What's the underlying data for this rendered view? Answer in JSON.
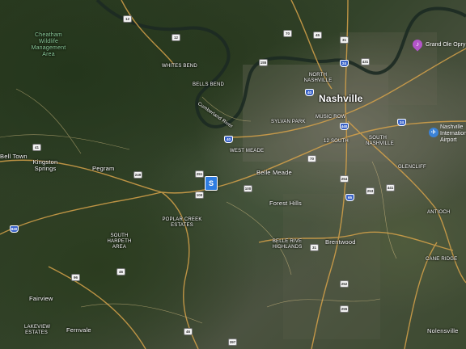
{
  "map": {
    "place_labels": {
      "cheatham": "Cheatham Wildlife Management Area",
      "whites_bend": "WHITES BEND",
      "bells_bend": "BELLS BEND",
      "cumberland_river": "Cumberland River",
      "nashville": "Nashville",
      "north_nashville": "NORTH NASHVILLE",
      "sylvan_park": "SYLVAN PARK",
      "music_row": "MUSIC ROW",
      "twelve_south": "12 SOUTH",
      "south_nashville": "SOUTH NASHVILLE",
      "west_meade": "WEST MEADE",
      "belle_meade": "Belle Meade",
      "forest_hills": "Forest Hills",
      "kingston_springs": "Kingston Springs",
      "pegram": "Pegram",
      "bell_town": "Bell Town",
      "poplar_creek": "POPLAR CREEK ESTATES",
      "south_harpeth": "SOUTH HARPETH AREA",
      "belle_rive": "BELLE RIVE HIGHLANDS",
      "brentwood": "Brentwood",
      "glencliff": "GLENCLIFF",
      "antioch": "ANTIOCH",
      "cane_ridge": "CANE RIDGE",
      "fairview": "Fairview",
      "lakeview_estates": "LAKEVIEW ESTATES",
      "fernvale": "Fernvale",
      "nolensville": "Nolensville"
    },
    "pois": {
      "opry": "Grand Ole Opry",
      "airport": "Nashville International Airport"
    },
    "marker_label": "S",
    "shields": {
      "s12": "12",
      "s13": "12",
      "s70a": "70",
      "s45": "45",
      "s24": "24",
      "s155": "155",
      "s431": "431",
      "s31": "31",
      "s40a": "40",
      "s40b": "40",
      "s440": "440",
      "s24b": "24",
      "s65": "65",
      "s70": "70",
      "s100": "100",
      "s251": "251",
      "s254": "254",
      "s100b": "100",
      "s249": "249",
      "s96": "96",
      "s31b": "31",
      "s252": "252",
      "s253": "253",
      "s397": "397",
      "s46": "46",
      "s840": "840",
      "s41": "41",
      "s441": "441",
      "s255": "255",
      "s46b": "46"
    }
  }
}
